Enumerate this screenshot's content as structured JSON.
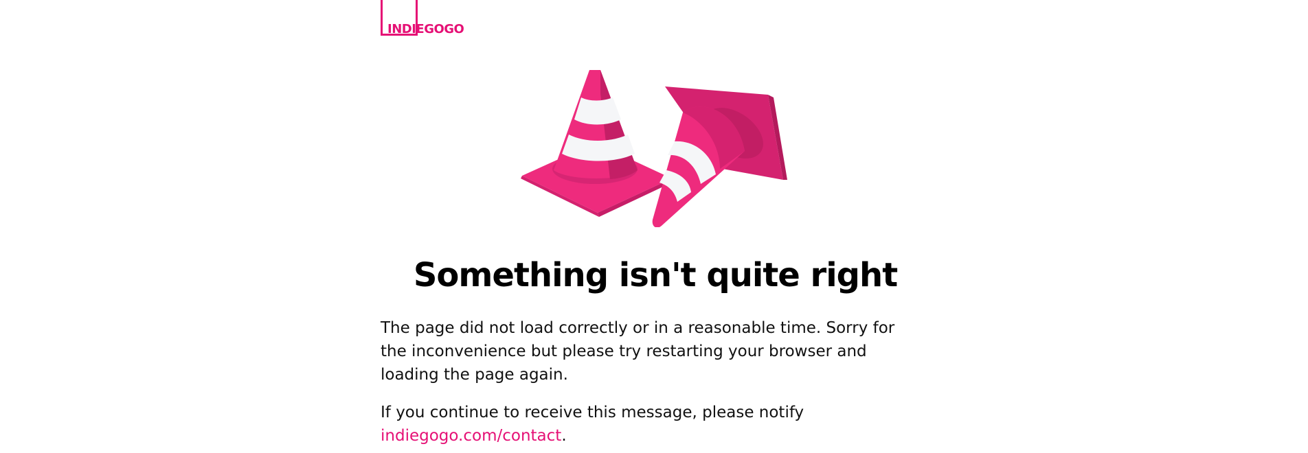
{
  "brand": {
    "logo_text": "INDIEGOGO",
    "accent_color": "#e51075"
  },
  "illustration": {
    "icon": "traffic-cones-icon"
  },
  "error": {
    "title": "Something isn't quite right",
    "paragraph_1": "The page did not load correctly or in a reasonable time. Sorry for the inconvenience but please try restarting your browser and loading the page again.",
    "paragraph_2_prefix": "If you continue to receive this message, please notify ",
    "contact_link_text": "indiegogo.com/contact",
    "paragraph_2_suffix": "."
  }
}
